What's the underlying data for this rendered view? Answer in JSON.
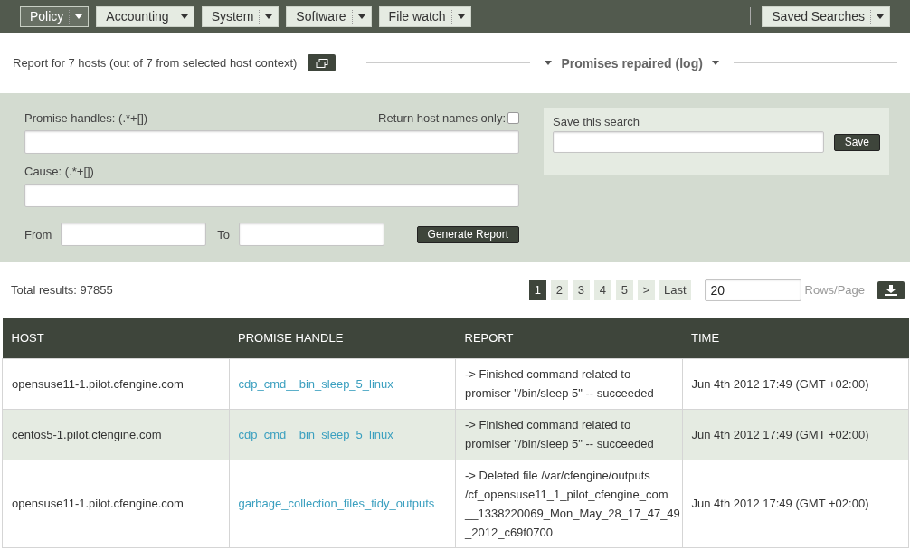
{
  "menu": [
    {
      "label": "Policy",
      "selected": true
    },
    {
      "label": "Accounting",
      "selected": false
    },
    {
      "label": "System",
      "selected": false
    },
    {
      "label": "Software",
      "selected": false
    },
    {
      "label": "File watch",
      "selected": false
    }
  ],
  "saved_searches": {
    "label": "Saved Searches"
  },
  "report_info": "Report for 7 hosts (out of 7 from selected host context)",
  "report_title": "Promises repaired (log)",
  "filters": {
    "handles_label": "Promise handles: (.*+[])",
    "host_names_label": "Return host names only:",
    "host_names_checked": false,
    "cause_label": "Cause: (.*+[])",
    "from_label": "From",
    "to_label": "To",
    "generate_button": "Generate Report"
  },
  "save_search": {
    "label": "Save this search",
    "button": "Save"
  },
  "total_results": "Total results: 97855",
  "pages": [
    {
      "label": "1",
      "selected": true
    },
    {
      "label": "2",
      "selected": false
    },
    {
      "label": "3",
      "selected": false
    },
    {
      "label": "4",
      "selected": false
    },
    {
      "label": "5",
      "selected": false
    },
    {
      "label": ">",
      "selected": false
    },
    {
      "label": "Last",
      "selected": false
    }
  ],
  "rows_per_page": {
    "value": "20",
    "label": "Rows/Page"
  },
  "table": {
    "columns": [
      "HOST",
      "PROMISE HANDLE",
      "REPORT",
      "TIME"
    ],
    "rows": [
      {
        "host": "opensuse11-1.pilot.cfengine.com",
        "handle": "cdp_cmd__bin_sleep_5_linux",
        "report": [
          "-> Finished command related to",
          "promiser \"/bin/sleep 5\" -- succeeded"
        ],
        "time": "Jun 4th 2012 17:49 (GMT +02:00)"
      },
      {
        "host": "centos5-1.pilot.cfengine.com",
        "handle": "cdp_cmd__bin_sleep_5_linux",
        "report": [
          "-> Finished command related to",
          "promiser \"/bin/sleep 5\" -- succeeded"
        ],
        "time": "Jun 4th 2012 17:49 (GMT +02:00)"
      },
      {
        "host": "opensuse11-1.pilot.cfengine.com",
        "handle": "garbage_collection_files_tidy_outputs",
        "report": [
          "-> Deleted file /var/cfengine/outputs",
          "/cf_opensuse11_1_pilot_cfengine_com",
          "__1338220069_Mon_May_28_17_47_49",
          "_2012_c69f0700"
        ],
        "time": "Jun 4th 2012 17:49 (GMT +02:00)"
      }
    ]
  }
}
